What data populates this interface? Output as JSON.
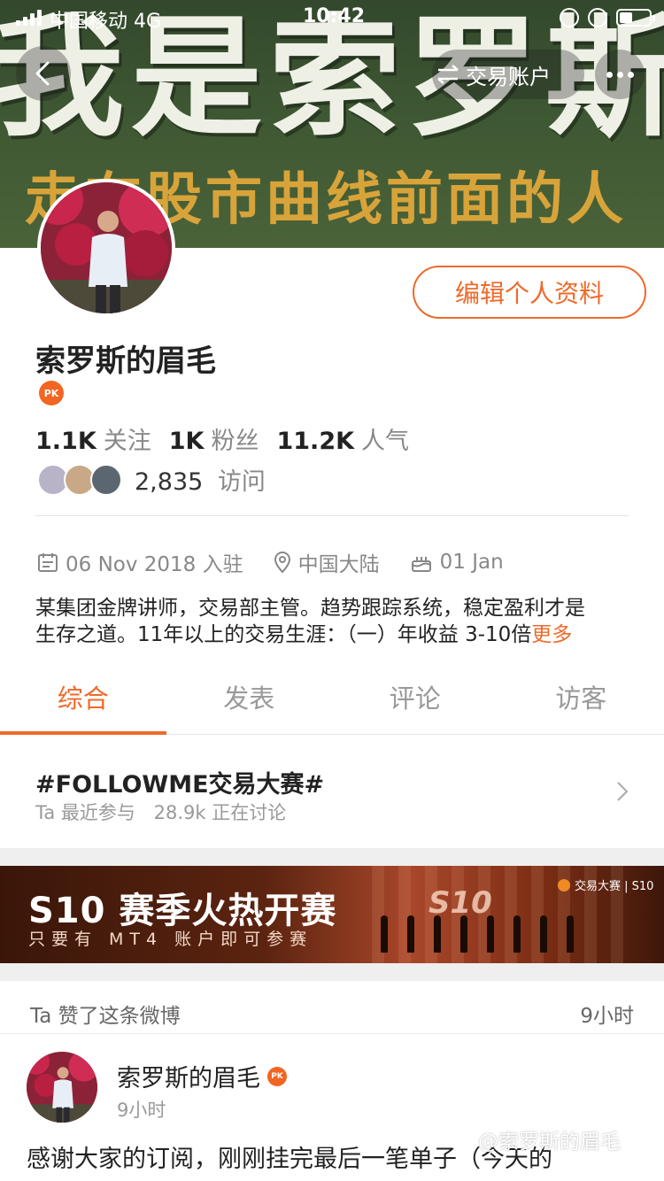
{
  "status_bar": {
    "carrier": "中国移动  4G",
    "time": "10:42"
  },
  "cover": {
    "title": "我是索罗斯",
    "subtitle": "走在股市曲线前面的人"
  },
  "nav": {
    "account_label": "交易账户"
  },
  "profile": {
    "edit_label": "编辑个人资料",
    "username": "索罗斯的眉毛",
    "badge": "PK",
    "stats": [
      {
        "value": "1.1K",
        "label": "关注"
      },
      {
        "value": "1K",
        "label": "粉丝"
      },
      {
        "value": "11.2K",
        "label": "人气"
      }
    ],
    "visit_count": "2,835",
    "visit_label": "访问",
    "join_date": "06 Nov 2018 入驻",
    "location": "中国大陆",
    "birthday": "01 Jan",
    "bio_line1": "某集团金牌讲师，交易部主管。趋势跟踪系统，稳定盈利才是",
    "bio_line2": "生存之道。11年以上的交易生涯：（一）年收益 3-10倍",
    "bio_more": "更多"
  },
  "tabs": [
    "综合",
    "发表",
    "评论",
    "访客"
  ],
  "topic": {
    "title": "#FOLLOWME交易大赛#",
    "meta_1": "Ta 最近参与",
    "meta_2": "28.9k 正在讨论"
  },
  "banner": {
    "title": "S10 赛季火热开赛",
    "subtitle": "只要有 MT4 账户即可参赛",
    "brand": "交易大赛 | S10",
    "stage_text": "S10"
  },
  "feed": {
    "liked_text": "Ta 赞了这条微博",
    "liked_time": "9小时",
    "author": "索罗斯的眉毛",
    "badge": "PK",
    "post_time": "9小时",
    "post_text": "感谢大家的订阅，刚刚挂完最后一笔单子（今天的"
  },
  "watermark": "@索罗斯的眉毛",
  "colors": {
    "accent": "#ee6a2b",
    "badge": "#f26522"
  }
}
